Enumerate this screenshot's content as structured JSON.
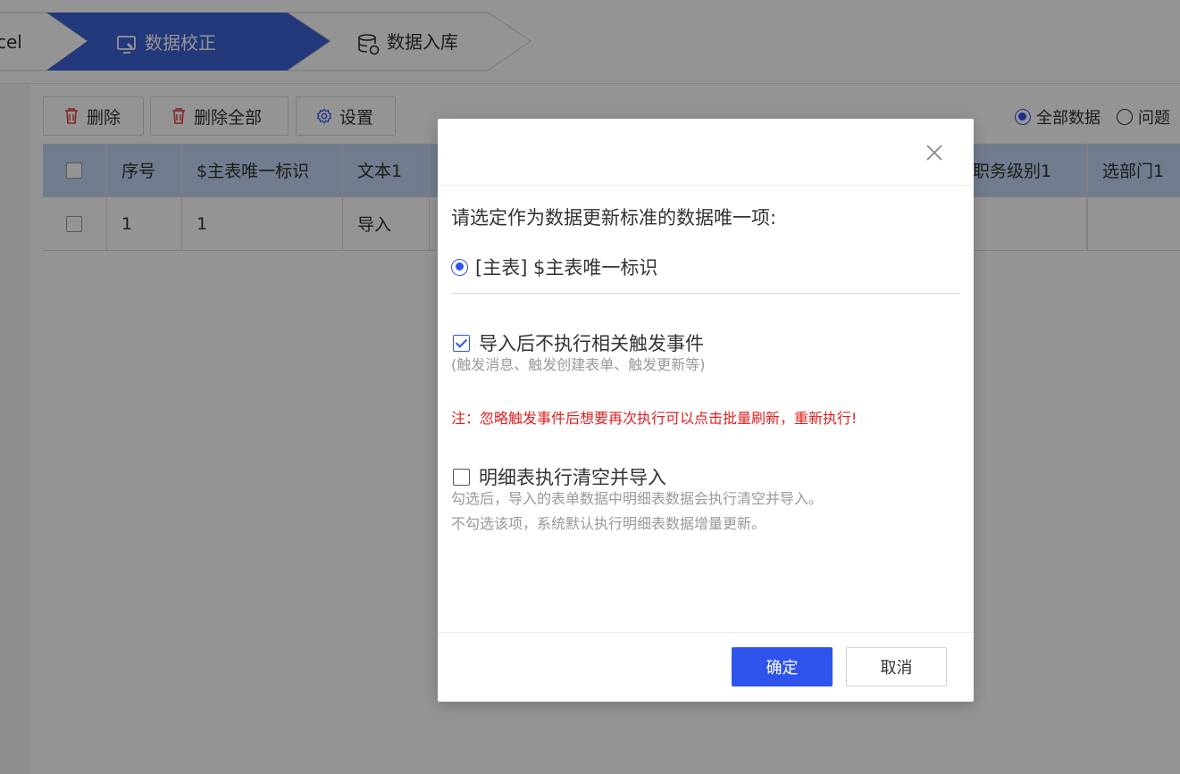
{
  "steps": {
    "excel_label": "cel",
    "verify_label": "数据校正",
    "store_label": "数据入库"
  },
  "toolbar": {
    "delete_label": "删除",
    "delete_all_label": "删除全部",
    "settings_label": "设置"
  },
  "filter": {
    "all_label": "全部数据",
    "issue_label": "问题"
  },
  "table": {
    "headers": [
      "序号",
      "$主表唯一标识",
      "文本1",
      "选职务级别1",
      "选部门1"
    ],
    "rows": [
      {
        "index": "1",
        "uid": "1",
        "text1": "导入",
        "level": "",
        "dept": ""
      }
    ]
  },
  "modal": {
    "prompt": "请选定作为数据更新标准的数据唯一项:",
    "unique_option": "[主表] $主表唯一标识",
    "no_trigger_label": "导入后不执行相关触发事件",
    "no_trigger_hint": "(触发消息、触发创建表单、触发更新等)",
    "warning": "注：忽略触发事件后想要再次执行可以点击批量刷新，重新执行!",
    "clear_detail_label": "明细表执行清空并导入",
    "clear_detail_hint1": "勾选后，导入的表单数据中明细表数据会执行清空并导入。",
    "clear_detail_hint2": "不勾选该项，系统默认执行明细表数据增量更新。",
    "ok_label": "确定",
    "cancel_label": "取消"
  },
  "colors": {
    "accent": "#2f54eb",
    "step_active": "#3d63d6",
    "table_header": "#c3d6f5",
    "warning": "#e02020"
  }
}
